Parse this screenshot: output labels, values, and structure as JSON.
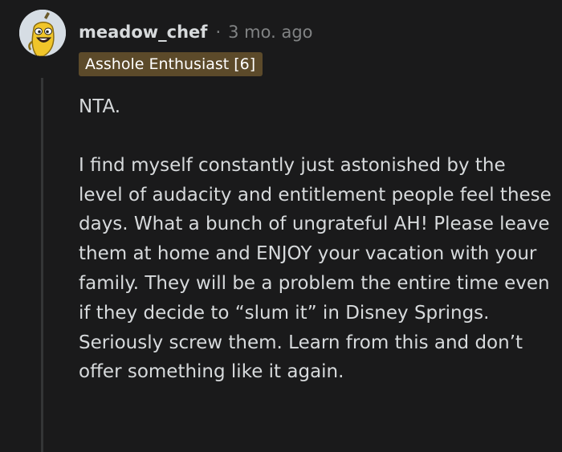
{
  "comment": {
    "username": "meadow_chef",
    "separator": "·",
    "timestamp": "3 mo. ago",
    "flair": "Asshole Enthusiast [6]",
    "flair_color": "#5c4a2a",
    "avatar_icon": "banana-snoo-avatar",
    "body": [
      "NTA.",
      "I find myself constantly just astonished by the level of audacity and entitlement people feel these days. What a bunch of ungrateful AH! Please leave them at home and ENJOY your vacation with your family. They will be a problem the entire time even if they decide to “slum it” in Disney Springs. Seriously screw them. Learn from this and don’t offer something like it again."
    ]
  }
}
